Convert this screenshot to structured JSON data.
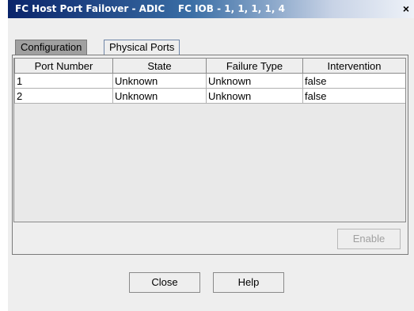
{
  "window": {
    "title": "FC Host Port Failover - ADIC    FC IOB - 1, 1, 1, 1, 4",
    "close_glyph": "×"
  },
  "tabs": [
    {
      "label": "Configuration",
      "selected": true
    },
    {
      "label": "Physical Ports",
      "selected": false
    }
  ],
  "table": {
    "columns": [
      "Port Number",
      "State",
      "Failure Type",
      "Intervention"
    ],
    "rows": [
      [
        "1",
        "Unknown",
        "Unknown",
        "false"
      ],
      [
        "2",
        "Unknown",
        "Unknown",
        "false"
      ]
    ]
  },
  "buttons": {
    "enable_label": "Enable",
    "enable_disabled": true,
    "close_label": "Close",
    "help_label": "Help"
  }
}
